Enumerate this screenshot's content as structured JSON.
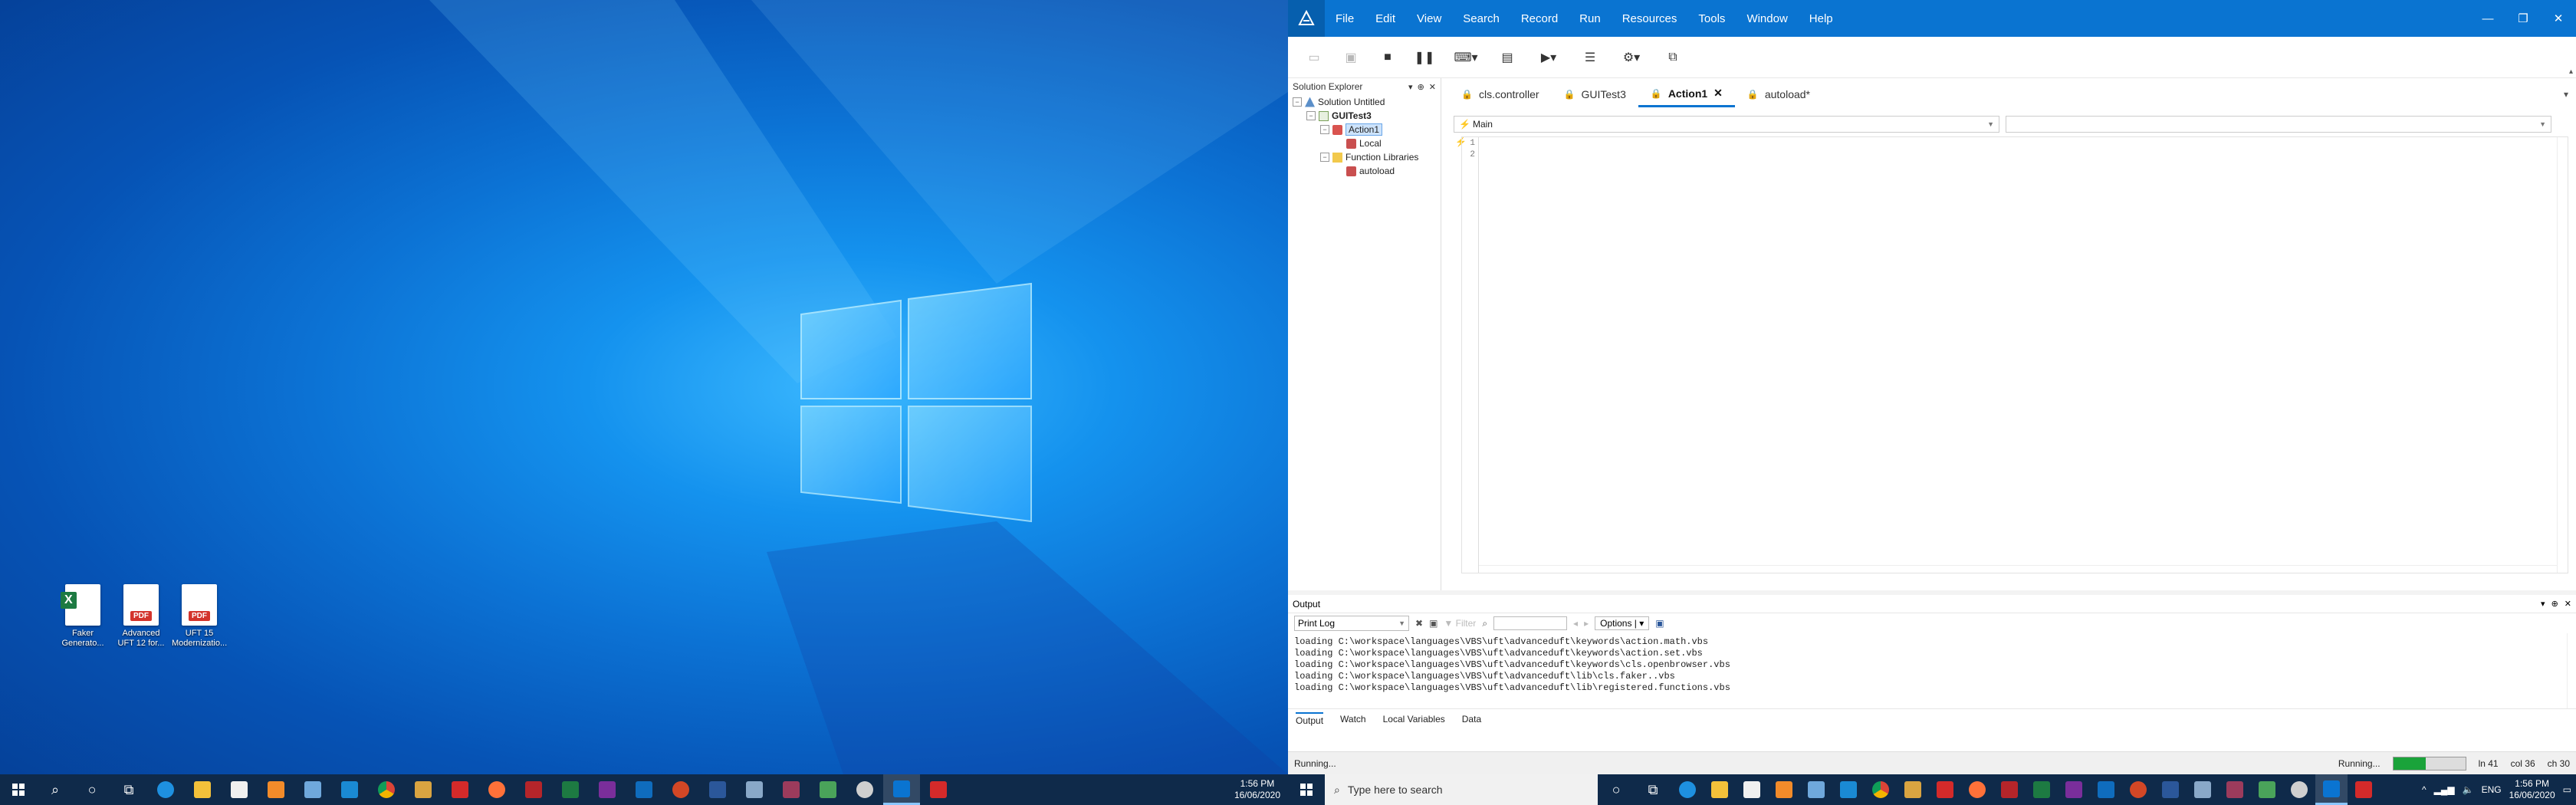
{
  "desktop": {
    "icons": [
      {
        "label": "Faker Generato...",
        "kind": "excel"
      },
      {
        "label": "Advanced UFT 12 for...",
        "kind": "pdf"
      },
      {
        "label": "UFT 15 Modernizatio...",
        "kind": "pdf"
      }
    ],
    "clock_time": "1:56 PM",
    "clock_date": "16/06/2020"
  },
  "app": {
    "menu": [
      "File",
      "Edit",
      "View",
      "Search",
      "Record",
      "Run",
      "Resources",
      "Tools",
      "Window",
      "Help"
    ],
    "explorer": {
      "title": "Solution Explorer",
      "solution": "Solution Untitled",
      "test": "GUITest3",
      "action": "Action1",
      "local": "Local",
      "libs": "Function Libraries",
      "lib": "autoload"
    },
    "tabs": [
      "cls.controller",
      "GUITest3",
      "Action1",
      "autoload*"
    ],
    "active_tab": "Action1",
    "editor": {
      "scope": "Main",
      "lines": [
        "1",
        "2"
      ]
    },
    "output": {
      "title": "Output",
      "log_selector": "Print Log",
      "filter_label": "Filter",
      "options_label": "Options",
      "log_lines": [
        "loading C:\\workspace\\languages\\VBS\\uft\\advanceduft\\keywords\\action.math.vbs",
        "loading C:\\workspace\\languages\\VBS\\uft\\advanceduft\\keywords\\action.set.vbs",
        "loading C:\\workspace\\languages\\VBS\\uft\\advanceduft\\keywords\\cls.openbrowser.vbs",
        "loading C:\\workspace\\languages\\VBS\\uft\\advanceduft\\lib\\cls.faker..vbs",
        "loading C:\\workspace\\languages\\VBS\\uft\\advanceduft\\lib\\registered.functions.vbs"
      ],
      "tabs": [
        "Output",
        "Watch",
        "Local Variables",
        "Data"
      ]
    },
    "status": {
      "left": "Running...",
      "state": "Running...",
      "progress": 0.45,
      "ln": "ln 41",
      "col": "col 36",
      "ch": "ch 30"
    },
    "search_placeholder": "Type here to search",
    "tray_lang": "ENG",
    "clock_time": "1:56 PM",
    "clock_date": "16/06/2020"
  },
  "colors": {
    "accent": "#0a74d1",
    "taskbar": "#0f2a4a",
    "progress": "#1aa33a"
  }
}
